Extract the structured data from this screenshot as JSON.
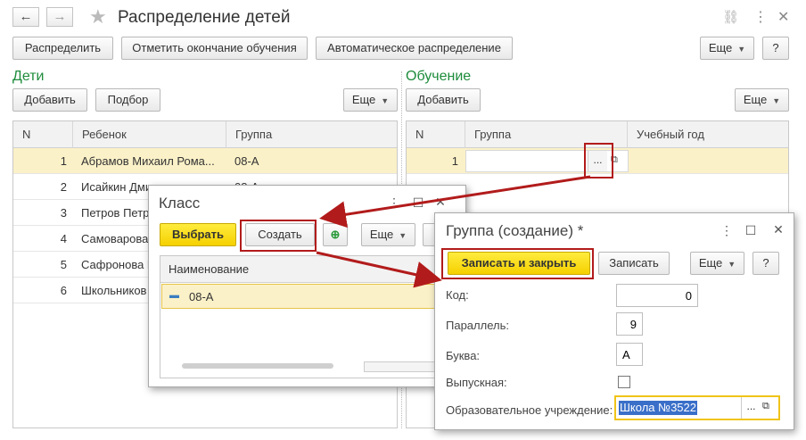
{
  "window": {
    "title": "Распределение детей",
    "back_icon": "arrow-left-icon",
    "forward_icon": "arrow-right-icon",
    "favorite_icon": "star-icon"
  },
  "toolbar": {
    "distribute": "Распределить",
    "mark_end": "Отметить окончание обучения",
    "auto_distribute": "Автоматическое распределение",
    "more": "Еще",
    "help": "?"
  },
  "children": {
    "section_title": "Дети",
    "add": "Добавить",
    "select": "Подбор",
    "more": "Еще",
    "columns": [
      "N",
      "Ребенок",
      "Группа"
    ],
    "rows": [
      {
        "n": "1",
        "child": "Абрамов Михаил Рома...",
        "group": "08-А"
      },
      {
        "n": "2",
        "child": "Исайкин Дмит",
        "group": "08-А"
      },
      {
        "n": "3",
        "child": "Петров Петр",
        "group": ""
      },
      {
        "n": "4",
        "child": "Самоварова",
        "group": ""
      },
      {
        "n": "5",
        "child": "Сафронова М",
        "group": ""
      },
      {
        "n": "6",
        "child": "Школьников",
        "group": ""
      }
    ]
  },
  "education": {
    "section_title": "Обучение",
    "add": "Добавить",
    "more": "Еще",
    "columns": [
      "N",
      "Группа",
      "Учебный год"
    ],
    "rows": [
      {
        "n": "1",
        "group": "",
        "year": ""
      }
    ],
    "picker_button": "..."
  },
  "class_dialog": {
    "title": "Класс",
    "choose": "Выбрать",
    "create": "Создать",
    "more": "Еще",
    "column": "Наименование",
    "items": [
      "08-А"
    ]
  },
  "group_dialog": {
    "title": "Группа (создание) *",
    "save_close": "Записать и закрыть",
    "save": "Записать",
    "more": "Еще",
    "help": "?",
    "fields": {
      "code_label": "Код:",
      "code_value": "0",
      "parallel_label": "Параллель:",
      "parallel_value": "9",
      "letter_label": "Буква:",
      "letter_value": "А",
      "graduate_label": "Выпускная:",
      "graduate_checked": false,
      "school_label": "Образовательное учреждение:",
      "school_value": "Школа №3522"
    }
  },
  "colors": {
    "accent_green": "#1e8c3c",
    "primary_yellow": "#f5d000",
    "selection_row": "#fbf1c8",
    "annotation_red": "#b21b1b"
  }
}
